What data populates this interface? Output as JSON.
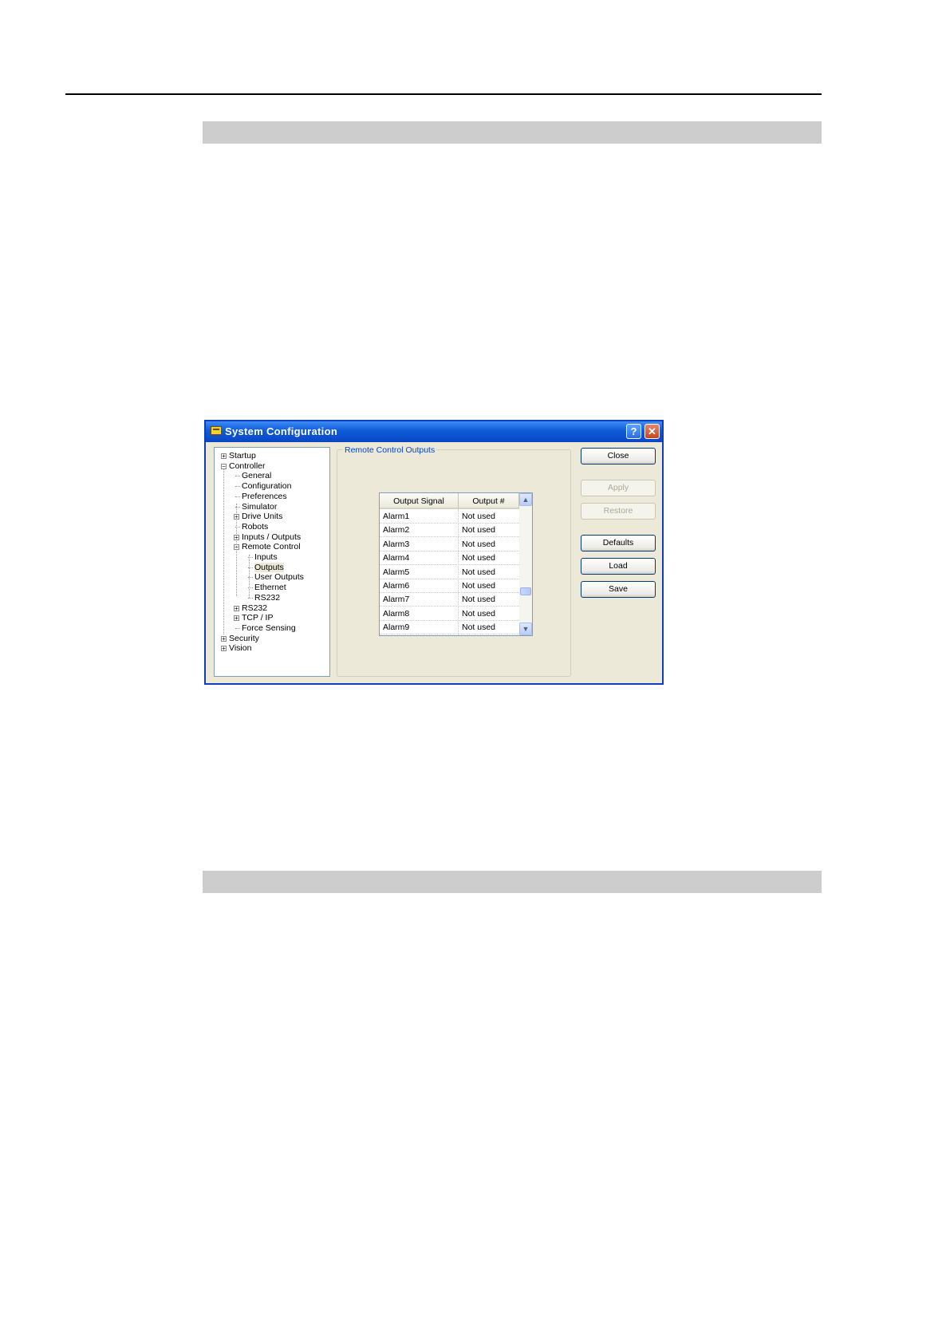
{
  "window": {
    "title": "System Configuration",
    "help_glyph": "?",
    "close_glyph": "✕",
    "icon": "app-icon"
  },
  "tree": {
    "items": [
      {
        "label": "Startup",
        "expander": "+"
      },
      {
        "label": "Controller",
        "expander": "−"
      },
      {
        "label": "General"
      },
      {
        "label": "Configuration"
      },
      {
        "label": "Preferences"
      },
      {
        "label": "Simulator"
      },
      {
        "label": "Drive Units",
        "expander": "+"
      },
      {
        "label": "Robots"
      },
      {
        "label": "Inputs / Outputs",
        "expander": "+"
      },
      {
        "label": "Remote Control",
        "expander": "−"
      },
      {
        "label": "Inputs"
      },
      {
        "label": "Outputs",
        "selected": true
      },
      {
        "label": "User Outputs"
      },
      {
        "label": "Ethernet"
      },
      {
        "label": "RS232"
      },
      {
        "label": "RS232",
        "expander": "+"
      },
      {
        "label": "TCP / IP",
        "expander": "+"
      },
      {
        "label": "Force Sensing"
      },
      {
        "label": "Security",
        "expander": "+"
      },
      {
        "label": "Vision",
        "expander": "+"
      }
    ]
  },
  "group": {
    "label": "Remote Control Outputs"
  },
  "table": {
    "columns": [
      "Output Signal",
      "Output #"
    ],
    "rows": [
      [
        "Alarm1",
        "Not used"
      ],
      [
        "Alarm2",
        "Not used"
      ],
      [
        "Alarm3",
        "Not used"
      ],
      [
        "Alarm4",
        "Not used"
      ],
      [
        "Alarm5",
        "Not used"
      ],
      [
        "Alarm6",
        "Not used"
      ],
      [
        "Alarm7",
        "Not used"
      ],
      [
        "Alarm8",
        "Not used"
      ],
      [
        "Alarm9",
        "Not used"
      ]
    ],
    "scroll_up_glyph": "▲",
    "scroll_down_glyph": "▼"
  },
  "buttons": {
    "close": "Close",
    "apply": "Apply",
    "restore": "Restore",
    "defaults": "Defaults",
    "load": "Load",
    "save": "Save"
  },
  "colors": {
    "titlebar": "#0f5bd8",
    "dialog_bg": "#ece9d8",
    "group_label": "#0046d5",
    "section_bar": "#cdcdcd"
  }
}
